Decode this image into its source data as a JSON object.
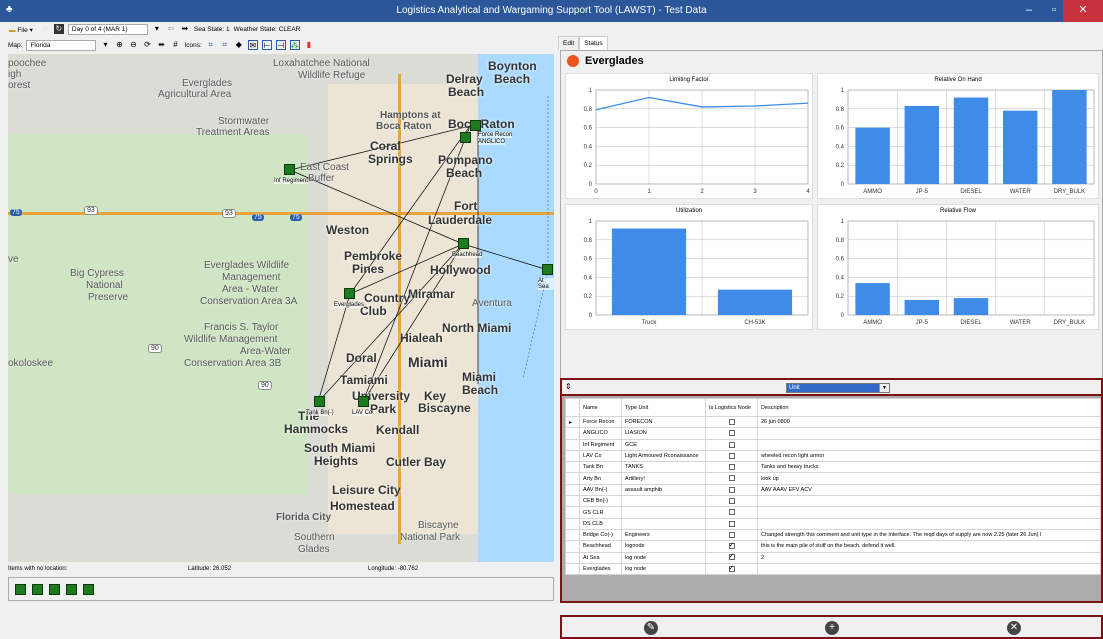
{
  "window": {
    "title": "Logistics Analytical and Wargaming Support Tool (LAWST) - Test Data"
  },
  "toolbar": {
    "file_label": "File",
    "day_select": "Day 0 of 4 (MAR 1)",
    "sea_state": "Sea State: 1",
    "weather_state": "Weather State: CLEAR"
  },
  "map_toolbar": {
    "map_label": "Map:",
    "map_select": "Florida",
    "icons_label": "Icons:"
  },
  "map": {
    "area_labels": [
      "Loxahatchee National",
      "Wildlife Refuge",
      "Everglades",
      "Agricultural Area",
      "Stormwater",
      "Treatment Areas",
      "East Coast",
      "Buffer",
      "Everglades Wildlife",
      "Management",
      "Area - Water",
      "Conservation Area 3A",
      "Big Cypress",
      "National",
      "Preserve",
      "Francis S. Taylor",
      "Wildlife Management",
      "Area-Water",
      "Conservation Area 3B",
      "Biscayne",
      "National Park",
      "Southern",
      "Glades"
    ],
    "city_labels": [
      "Boynton",
      "Beach",
      "Delray",
      "Beach",
      "Hamptons at",
      "Boca Raton",
      "Boca Raton",
      "Coral",
      "Springs",
      "Pompano",
      "Beach",
      "Fort",
      "Lauderdale",
      "Weston",
      "Pembroke",
      "Pines",
      "Hollywood",
      "Miramar",
      "Aventura",
      "Country",
      "Club",
      "Hialeah",
      "North Miami",
      "Doral",
      "Miami",
      "Tamiami",
      "Miami",
      "Beach",
      "University",
      "Park",
      "Key",
      "Biscayne",
      "The",
      "Hammocks",
      "Kendall",
      "South Miami",
      "Heights",
      "Cutler Bay",
      "Leisure City",
      "Homestead",
      "Florida City"
    ],
    "edge_labels": [
      "poochee",
      "igh",
      "orest",
      "ve",
      "okoloskee"
    ],
    "shields": [
      "93",
      "93",
      "75",
      "75",
      "75",
      "90",
      "90"
    ],
    "node_labels": [
      "Inf Regiment",
      "Force Recon",
      "ANGLICO",
      "Beachhead",
      "At Sea",
      "Everglades",
      "Tank Bn(-)",
      "LAV Co"
    ]
  },
  "statusbar": {
    "no_location": "Items with no location:",
    "latitude": "Latitude: 26.052",
    "longitude": "Longitude: -80.762"
  },
  "tabs": {
    "edit": "Edit",
    "status": "Status"
  },
  "status": {
    "node_name": "Everglades",
    "dot_color": "#e8541c"
  },
  "chart_data": [
    {
      "type": "line",
      "title": "Limiting Factor",
      "x": [
        0,
        1,
        2,
        3,
        4
      ],
      "values": [
        0.79,
        0.92,
        0.82,
        0.83,
        0.86
      ],
      "ylim": [
        0,
        1
      ],
      "yticks": [
        "0",
        "0.2",
        "0.4",
        "0.6",
        "0.8",
        "1"
      ],
      "xticks": [
        "0",
        "1",
        "2",
        "3",
        "4"
      ],
      "color": "#3e8ce8"
    },
    {
      "type": "bar",
      "title": "Relative On Hand",
      "categories": [
        "AMMO",
        "JP-5",
        "DIESEL",
        "WATER",
        "DRY_BULK"
      ],
      "values": [
        0.6,
        0.83,
        0.92,
        0.78,
        1.0
      ],
      "ylim": [
        0,
        1
      ],
      "yticks": [
        "0",
        "0.2",
        "0.4",
        "0.6",
        "0.8",
        "1"
      ],
      "color": "#3e8ce8"
    },
    {
      "type": "bar",
      "title": "Utilization",
      "categories": [
        "Truck",
        "CH-53K"
      ],
      "values": [
        0.92,
        0.27
      ],
      "ylim": [
        0,
        1
      ],
      "yticks": [
        "0",
        "0.2",
        "0.4",
        "0.6",
        "0.8",
        "1"
      ],
      "color": "#3e8ce8"
    },
    {
      "type": "bar",
      "title": "Relative Flow",
      "categories": [
        "AMMO",
        "JP-5",
        "DIESEL",
        "WATER",
        "DRY_BULK"
      ],
      "values": [
        0.34,
        0.16,
        0.18,
        0,
        0
      ],
      "ylim": [
        0,
        1
      ],
      "yticks": [
        "0",
        "0.2",
        "0.4",
        "0.6",
        "0.8",
        "1"
      ],
      "color": "#3e8ce8"
    }
  ],
  "grid": {
    "selector_value": "Unit",
    "headers": [
      "Name",
      "Type Unit",
      "Is Logistics Node",
      "Description"
    ],
    "rows": [
      {
        "name": "Force Recon",
        "type": "FORECON",
        "log": false,
        "desc": "26 jun 0800"
      },
      {
        "name": "ANGLICO",
        "type": "LIASION",
        "log": false,
        "desc": ""
      },
      {
        "name": "Inf Regiment",
        "type": "GCE",
        "log": false,
        "desc": ""
      },
      {
        "name": "LAV Co",
        "type": "Light Armoured Rconaissance",
        "log": false,
        "desc": "wheeled recon light armor"
      },
      {
        "name": "Tank Bn",
        "type": "TANKS",
        "log": false,
        "desc": "Tanks and heavy trucks"
      },
      {
        "name": "Arty Bn",
        "type": "Artillery!",
        "log": false,
        "desc": "look up"
      },
      {
        "name": "AAV Bn(-)",
        "type": "assault amphib",
        "log": false,
        "desc": "AAV AAAV EFV ACV"
      },
      {
        "name": "CEB Bn(-)",
        "type": "",
        "log": false,
        "desc": ""
      },
      {
        "name": "GS CLR",
        "type": "",
        "log": false,
        "desc": ""
      },
      {
        "name": "DS CLB",
        "type": "",
        "log": false,
        "desc": ""
      },
      {
        "name": "Bridge Co(-)",
        "type": "Engineers",
        "log": false,
        "desc": "Changed strength this comment and unit type in the interface. The reqd days of supply are now 2.25 (later 26 Jun) l"
      },
      {
        "name": "Beachhead",
        "type": "lognode",
        "log": true,
        "desc": "this is the main pile of stuff on the beach. defend it well."
      },
      {
        "name": "At Sea",
        "type": "log node",
        "log": true,
        "desc": "2"
      },
      {
        "name": "Everglades",
        "type": "log node",
        "log": true,
        "desc": ""
      }
    ]
  }
}
